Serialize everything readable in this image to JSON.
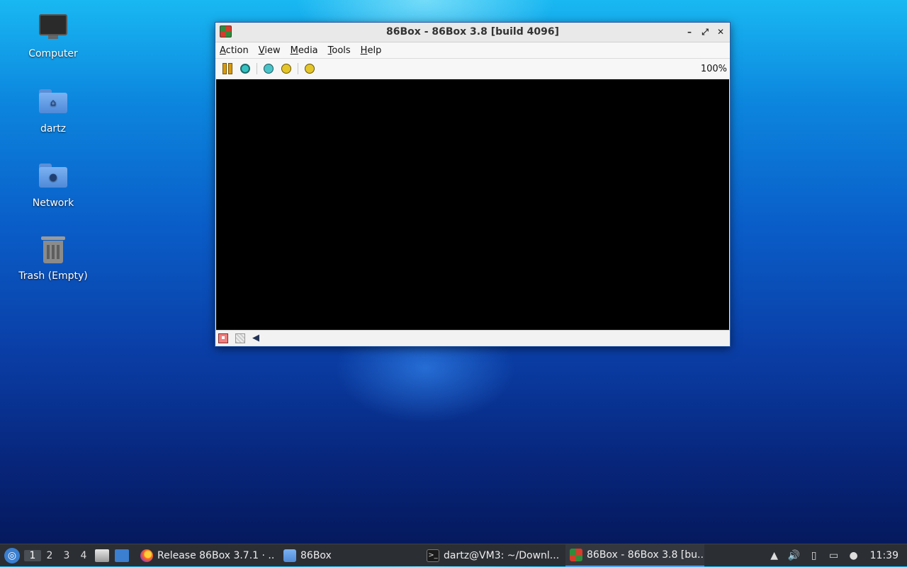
{
  "desktop": {
    "icons": [
      {
        "label": "Computer"
      },
      {
        "label": "dartz"
      },
      {
        "label": "Network"
      },
      {
        "label": "Trash (Empty)"
      }
    ]
  },
  "window": {
    "title": "86Box - 86Box 3.8 [build 4096]",
    "controls": {
      "minimize": "–",
      "maximize": "⤢",
      "close": "✕"
    },
    "menu": [
      "Action",
      "View",
      "Media",
      "Tools",
      "Help"
    ],
    "toolbar": {
      "buttons": [
        "pause-icon",
        "hard-reset-icon",
        "ctrl-alt-del-icon",
        "ctrl-alt-esc-icon",
        "settings-icon"
      ],
      "zoom": "100%"
    },
    "statusbar": [
      "floppy-drive-icon",
      "hard-disk-icon",
      "sound-icon"
    ]
  },
  "taskbar": {
    "start_icon": "start-menu-icon",
    "workspaces": [
      "1",
      "2",
      "3",
      "4"
    ],
    "active_workspace": "1",
    "tasks": [
      {
        "label": "Release 86Box 3.7.1 · ...",
        "icon": "firefox-icon"
      },
      {
        "label": "86Box",
        "icon": "folder-icon"
      },
      {
        "label": "dartz@VM3: ~/Downl...",
        "icon": "terminal-icon"
      },
      {
        "label": "86Box - 86Box 3.8 [bu...",
        "icon": "86box-icon",
        "active": true
      }
    ],
    "clock": "11:39"
  },
  "colors": {
    "taskbar_bg": "#2b2e33",
    "active_task_accent": "#4aa3ff",
    "window_border": "#2b5aa5"
  }
}
